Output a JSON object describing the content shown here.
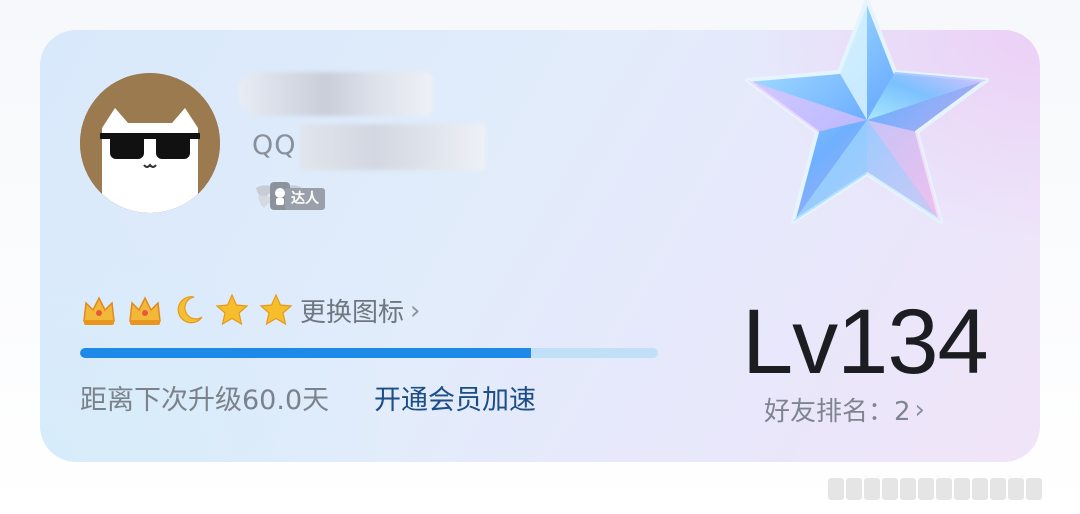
{
  "profile": {
    "qq_prefix": "QQ",
    "badge_label": "达人"
  },
  "level": {
    "icons": [
      "crown-icon",
      "crown-icon",
      "moon-icon",
      "star-icon",
      "star-icon"
    ],
    "change_icon_label": "更换图标",
    "progress_percent": 78,
    "upgrade_text": "距离下次升级60.0天",
    "vip_link": "开通会员加速",
    "value": "Lv134",
    "rank_text": "好友排名：2"
  },
  "colors": {
    "progress_fill": "#1e8ae8",
    "progress_track": "#bfe0f7",
    "vip_link": "#1b4d86"
  }
}
